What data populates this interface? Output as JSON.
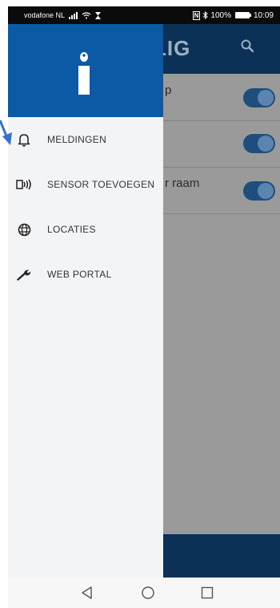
{
  "status_bar": {
    "carrier": "vodafone NL",
    "nfc_label": "N",
    "battery_text": "100%",
    "time": "10:09"
  },
  "background_app": {
    "title_fragment": "LIG",
    "rows": [
      {
        "label": "p",
        "toggle_on": true
      },
      {
        "label": "",
        "toggle_on": true
      },
      {
        "label": "r raam",
        "toggle_on": true
      }
    ]
  },
  "drawer": {
    "logo": "i",
    "items": [
      {
        "label": "MELDINGEN",
        "icon": "bell-icon"
      },
      {
        "label": "SENSOR TOEVOEGEN",
        "icon": "sensor-icon"
      },
      {
        "label": "LOCATIES",
        "icon": "globe-icon"
      },
      {
        "label": "WEB PORTAL",
        "icon": "wrench-icon"
      }
    ]
  },
  "colors": {
    "drawer_header": "#0b5aa5",
    "app_header": "#0c3157",
    "toggle": "#1f4e7d",
    "scrim": "#9a9a9a",
    "arrow": "#3a6fd0"
  }
}
